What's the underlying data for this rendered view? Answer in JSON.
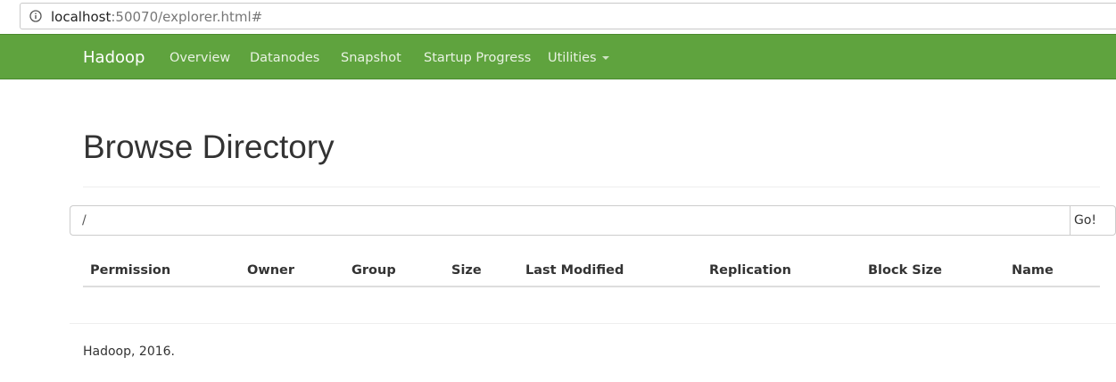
{
  "browser": {
    "url_host": "localhost",
    "url_path": ":50070/explorer.html#"
  },
  "navbar": {
    "brand": "Hadoop",
    "items": [
      {
        "label": "Overview"
      },
      {
        "label": "Datanodes"
      },
      {
        "label": "Snapshot"
      },
      {
        "label": "Startup Progress"
      },
      {
        "label": "Utilities",
        "has_dropdown": true
      }
    ],
    "color": "#5fa33e"
  },
  "main": {
    "title": "Browse Directory",
    "directory": {
      "value": "/",
      "go_label": "Go!"
    },
    "table": {
      "columns": [
        "Permission",
        "Owner",
        "Group",
        "Size",
        "Last Modified",
        "Replication",
        "Block Size",
        "Name"
      ],
      "rows": []
    }
  },
  "footer": {
    "text": "Hadoop, 2016."
  }
}
